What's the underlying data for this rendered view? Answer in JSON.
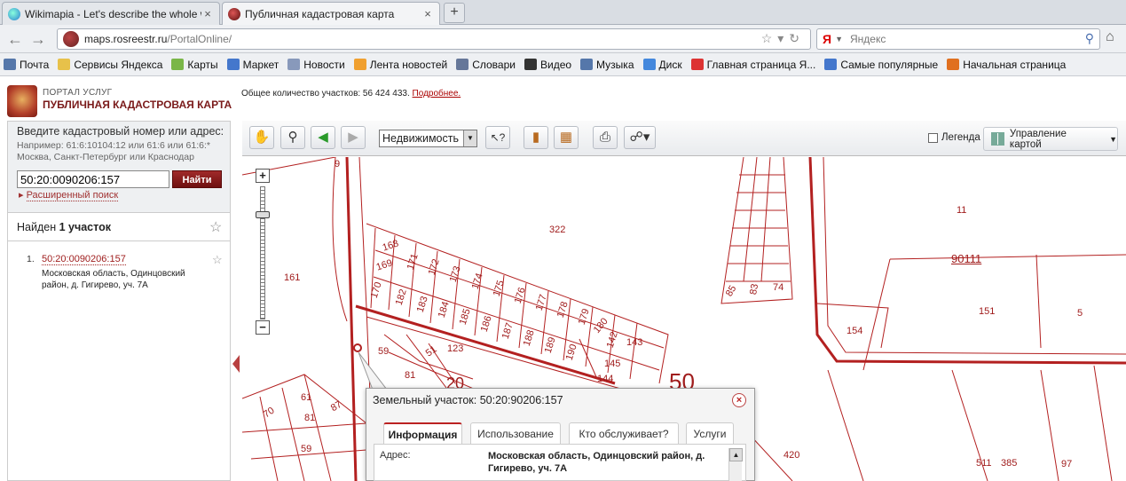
{
  "browser": {
    "tabs": [
      {
        "title": "Wikimapia - Let's describe the whole world!",
        "color": "#4a8fd8"
      },
      {
        "title": "Публичная кадастровая карта",
        "color": "#8b1a1a"
      }
    ],
    "new_tab": "+",
    "close": "×",
    "url_host": "maps.rosreestr.ru",
    "url_path": "/PortalOnline/",
    "search_engine_glyph": "Я",
    "search_placeholder": "Яндекс",
    "bookmarks": [
      {
        "label": "Почта",
        "icon": "mail-icon",
        "color": "#5577aa"
      },
      {
        "label": "Сервисы Яндекса",
        "icon": "folder-icon",
        "color": "#e7c14a"
      },
      {
        "label": "Карты",
        "icon": "map-icon",
        "color": "#7ab648"
      },
      {
        "label": "Маркет",
        "icon": "market-icon",
        "color": "#4477cc"
      },
      {
        "label": "Новости",
        "icon": "page-icon",
        "color": "#8899bb"
      },
      {
        "label": "Лента новостей",
        "icon": "rss-icon",
        "color": "#f0a030"
      },
      {
        "label": "Словари",
        "icon": "dictionary-icon",
        "color": "#667799"
      },
      {
        "label": "Видео",
        "icon": "video-icon",
        "color": "#333333"
      },
      {
        "label": "Музыка",
        "icon": "music-icon",
        "color": "#5577aa"
      },
      {
        "label": "Диск",
        "icon": "disk-icon",
        "color": "#4488dd"
      },
      {
        "label": "Главная страница Я...",
        "icon": "yandex-icon",
        "color": "#dd3333"
      },
      {
        "label": "Самые популярные",
        "icon": "popular-icon",
        "color": "#4477cc"
      },
      {
        "label": "Начальная страница",
        "icon": "firefox-icon",
        "color": "#e07020"
      }
    ]
  },
  "portal": {
    "line1": "ПОРТАЛ УСЛУГ",
    "line2": "ПУБЛИЧНАЯ КАДАСТРОВАЯ КАРТА",
    "count_text": "Общее количество участков: 56 424 433.",
    "more_link": "Подробнее."
  },
  "search": {
    "title": "Введите кадастровый номер или адрес:",
    "hint1": "Например: 61:6:10104:12 или 61:6 или 61:6:*",
    "hint2": "Москва, Санкт-Петербург или Краснодар",
    "value": "50:20:0090206:157",
    "button": "Найти",
    "advanced": "Расширенный поиск"
  },
  "results": {
    "found_prefix": "Найден ",
    "found_bold": "1 участок",
    "items": [
      {
        "num": "1.",
        "id": "50:20:0090206:157",
        "address": "Московская область, Одинцовский район, д. Гигирево, уч. 7А"
      }
    ]
  },
  "toolbar": {
    "layer": "Недвижимость",
    "legend": "Легенда",
    "manage": "Управление картой",
    "accent": "#8b1a1a"
  },
  "map_labels": {
    "l9": "9",
    "l322": "322",
    "l11": "11",
    "l90111": "90111",
    "l161": "161",
    "l168": "168",
    "l169": "169",
    "l170": "170",
    "l171": "171",
    "l172": "172",
    "l173": "173",
    "l174": "174",
    "l175": "175",
    "l176": "176",
    "l177": "177",
    "l178": "178",
    "l179": "179",
    "l180": "180",
    "l182": "182",
    "l183": "183",
    "l184": "184",
    "l185": "185",
    "l186": "186",
    "l187": "187",
    "l188": "188",
    "l189": "189",
    "l190": "190",
    "l142": "142",
    "l143": "143",
    "l145": "145",
    "l144": "144",
    "l85": "85",
    "l83": "83",
    "l74": "74",
    "l151": "151",
    "l5": "5",
    "l154": "154",
    "l59": "59",
    "l51": "51",
    "l123": "123",
    "l81": "81",
    "l20": "20",
    "l50": "50",
    "l70": "70",
    "l61": "61",
    "l87": "87",
    "l81b": "81",
    "l59b": "59",
    "l420": "420",
    "l511": "511",
    "l385": "385",
    "l97": "97"
  },
  "popup": {
    "title": "Земельный участок: 50:20:90206:157",
    "close": "×",
    "tabs": [
      "Информация",
      "Использование",
      "Кто обслуживает?",
      "Услуги"
    ],
    "address_label": "Адрес:",
    "address_value": "Московская область, Одинцовский район, д. Гигирево, уч. 7А"
  }
}
